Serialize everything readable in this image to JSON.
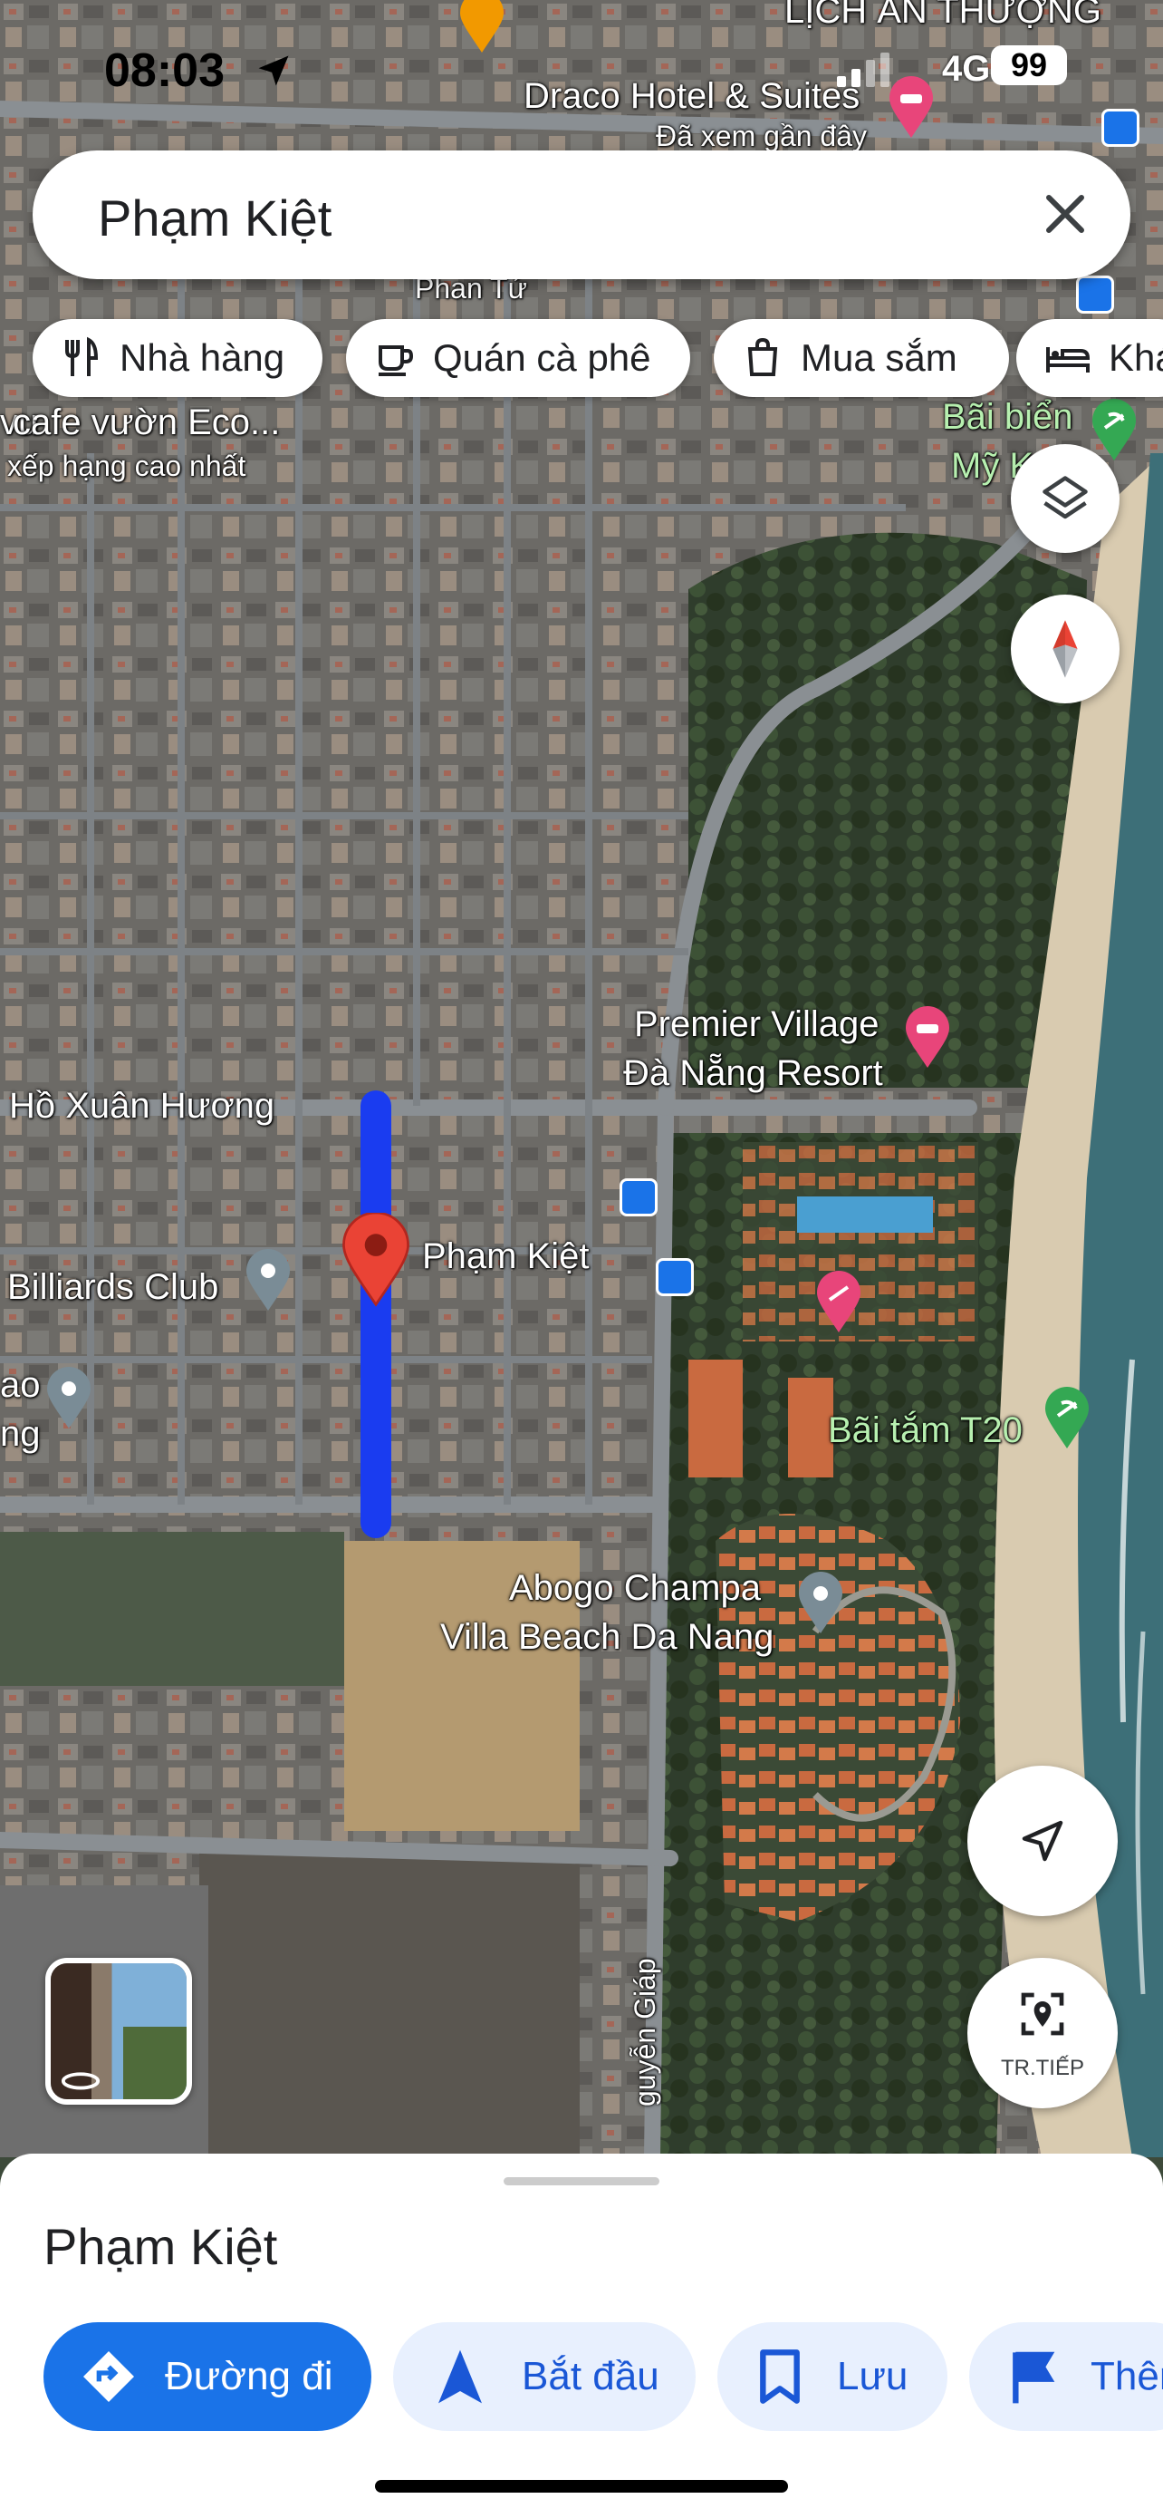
{
  "status_bar": {
    "time": "08:03",
    "network": "4G",
    "battery": "99"
  },
  "search": {
    "query": "Phạm Kiệt"
  },
  "chips": [
    {
      "label": "Nhà hàng",
      "icon": "restaurant-icon"
    },
    {
      "label": "Quán cà phê",
      "icon": "coffee-icon"
    },
    {
      "label": "Mua sắm",
      "icon": "shopping-bag-icon"
    },
    {
      "label": "Khá",
      "icon": "hotel-icon"
    }
  ],
  "map": {
    "labels": {
      "lich_an_thuong": "LỊCH ẨN THƯỢNG",
      "draco": "Draco Hotel & Suites",
      "draco_sub": "Đã xem gần đây",
      "phan_tu": "Phan Tứ",
      "cafe_vuon": "cafe vườn Eco...",
      "cafe_vuon_pre": "vu",
      "cafe_vuon_sub": "xếp hạng cao nhất",
      "bai_bien": "Bãi biển",
      "bai_bien_2": "Mỹ K",
      "premier_1": "Premier Village",
      "premier_2": "Đà Nẵng Resort",
      "ho_xuan_huong": "Hồ Xuân Hương",
      "pham_kiet": "Phạm Kiệt",
      "billiards": "Billiards Club",
      "ao": "ao",
      "ng": "ng",
      "bai_tam": "Bãi tắm T20",
      "abogo_1": "Abogo Champa",
      "abogo_2": "Villa Beach Da Nang",
      "nguyen_giap": "guyễn Giáp"
    }
  },
  "controls": {
    "transit_label": "TR.TIẾP"
  },
  "sheet": {
    "title": "Phạm Kiệt",
    "actions": {
      "directions": "Đường đi",
      "start": "Bắt đầu",
      "save": "Lưu",
      "more": "Thêm"
    }
  },
  "colors": {
    "accent": "#1a73e8",
    "route": "#1a3cf0",
    "pin_red": "#ea4335",
    "chip_bg": "#ffffff",
    "action_light": "#e8f0fe"
  }
}
